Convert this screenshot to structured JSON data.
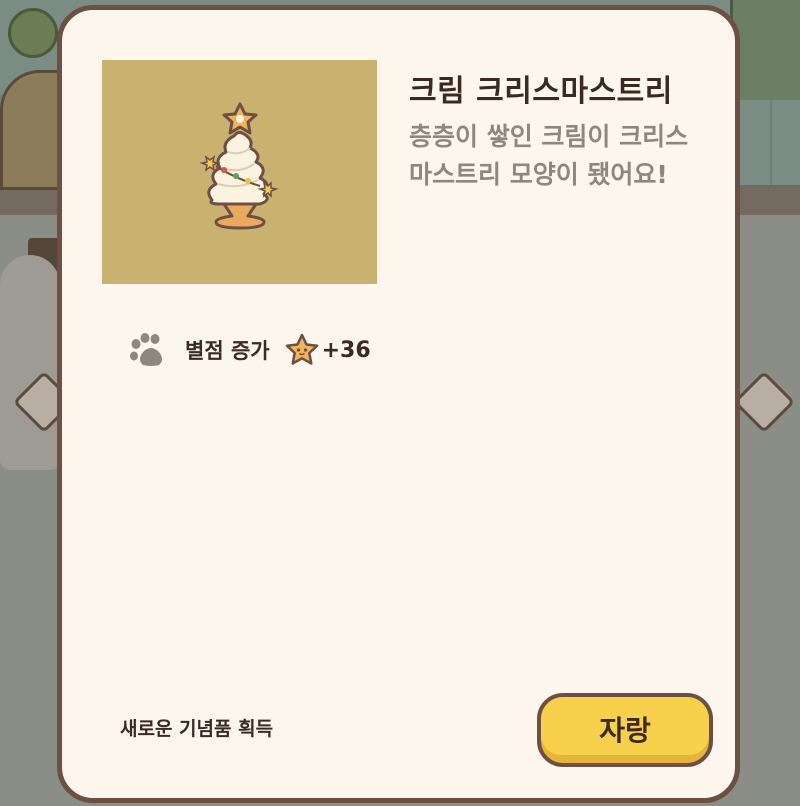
{
  "item": {
    "name": "크림 크리스마스트리",
    "description": "층층이 쌓인 크림이 크리스마스트리 모양이 됐어요!",
    "image_background": "#c9b26f"
  },
  "stat": {
    "icon": "paw-icon",
    "label": "별점 증가",
    "reward_icon": "star-icon",
    "value": "+36"
  },
  "footer": {
    "notice": "새로운 기념품 획득",
    "brag_button_label": "자랑",
    "button_color": "#f8d14c"
  },
  "colors": {
    "panel": "#fdf6ec",
    "border": "#6e4f43",
    "text": "#3a2a22",
    "muted_text": "#8e8780"
  }
}
